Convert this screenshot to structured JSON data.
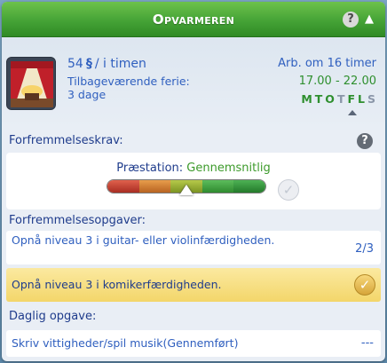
{
  "header": {
    "title": "Opvarmeren",
    "help": "?",
    "collapse": "▲"
  },
  "job": {
    "salary_amount": "54",
    "salary_symbol": "§",
    "salary_unit": "/ i timen",
    "vacation_label": "Tilbageværende ferie:",
    "vacation_value": "3 dage",
    "work_label": "Arb. om 16 timer",
    "work_hours": "17.00 - 22.00",
    "days": [
      {
        "letter": "M",
        "active": true
      },
      {
        "letter": "T",
        "active": true
      },
      {
        "letter": "O",
        "active": true
      },
      {
        "letter": "T",
        "active": false
      },
      {
        "letter": "F",
        "active": true
      },
      {
        "letter": "L",
        "active": true
      },
      {
        "letter": "S",
        "active": false
      }
    ]
  },
  "promotion": {
    "heading": "Forfremmelseskrav:",
    "help": "?",
    "performance_label": "Præstation:",
    "performance_value": "Gennemsnitlig",
    "performance_level": 0.5
  },
  "tasks": {
    "heading": "Forfremmelsesopgaver:",
    "items": [
      {
        "text": "Opnå niveau 3 i guitar- eller violinfærdigheden.",
        "progress": "2/3",
        "done": false
      },
      {
        "text": "Opnå niveau 3 i komikerfærdigheden.",
        "progress": "",
        "done": true
      }
    ]
  },
  "daily": {
    "heading": "Daglig opgave:",
    "text": "Skriv vittigheder/spil musik(Gennemført)",
    "progress": "---"
  },
  "colors": {
    "header_green": "#45a336",
    "text_blue": "#2f5fbf",
    "active_green": "#2e8f2e",
    "highlight_gold": "#f3d66a"
  },
  "icons": {
    "career": "stage-curtain-icon",
    "check_pending": "check-circle-grey-icon",
    "check_done": "check-circle-gold-icon"
  }
}
